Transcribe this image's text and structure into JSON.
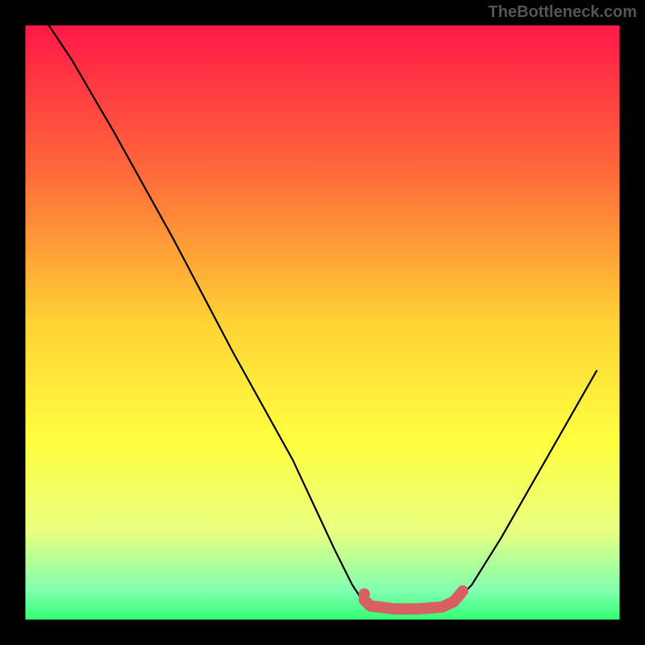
{
  "watermark": "TheBottleneck.com",
  "chart_data": {
    "type": "line",
    "title": "",
    "xlabel": "",
    "ylabel": "",
    "xlim": [
      0,
      100
    ],
    "ylim": [
      0,
      100
    ],
    "background": {
      "type": "vertical_gradient",
      "stops": [
        {
          "offset": 0,
          "color": "#ff1848"
        },
        {
          "offset": 25,
          "color": "#ff6a3a"
        },
        {
          "offset": 50,
          "color": "#ffd234"
        },
        {
          "offset": 70,
          "color": "#ffff40"
        },
        {
          "offset": 85,
          "color": "#e8ff80"
        },
        {
          "offset": 95,
          "color": "#80ffb0"
        },
        {
          "offset": 100,
          "color": "#30ff70"
        }
      ]
    },
    "series": [
      {
        "name": "bottleneck-curve",
        "color": "#000000",
        "stroke_width": 2,
        "points": [
          {
            "x": 4,
            "y": 100
          },
          {
            "x": 8,
            "y": 94
          },
          {
            "x": 15,
            "y": 82
          },
          {
            "x": 25,
            "y": 64
          },
          {
            "x": 35,
            "y": 45
          },
          {
            "x": 45,
            "y": 27
          },
          {
            "x": 52,
            "y": 12
          },
          {
            "x": 55,
            "y": 6
          },
          {
            "x": 57,
            "y": 3
          },
          {
            "x": 60,
            "y": 2
          },
          {
            "x": 65,
            "y": 2
          },
          {
            "x": 70,
            "y": 2
          },
          {
            "x": 72,
            "y": 3
          },
          {
            "x": 75,
            "y": 6
          },
          {
            "x": 80,
            "y": 14
          },
          {
            "x": 88,
            "y": 28
          },
          {
            "x": 96,
            "y": 42
          }
        ]
      },
      {
        "name": "optimal-zone-marker",
        "color": "#d86060",
        "stroke_width": 12,
        "points": [
          {
            "x": 57,
            "y": 3.5
          },
          {
            "x": 58,
            "y": 2.5
          },
          {
            "x": 62,
            "y": 2
          },
          {
            "x": 66,
            "y": 2
          },
          {
            "x": 70,
            "y": 2.3
          },
          {
            "x": 72,
            "y": 3.2
          },
          {
            "x": 73.5,
            "y": 5
          }
        ]
      }
    ],
    "marker_dot": {
      "x": 57,
      "y": 4.5,
      "r": 7,
      "color": "#d86060"
    }
  },
  "colors": {
    "black": "#000000",
    "salmon": "#d86060",
    "watermark_text": "#555555"
  }
}
